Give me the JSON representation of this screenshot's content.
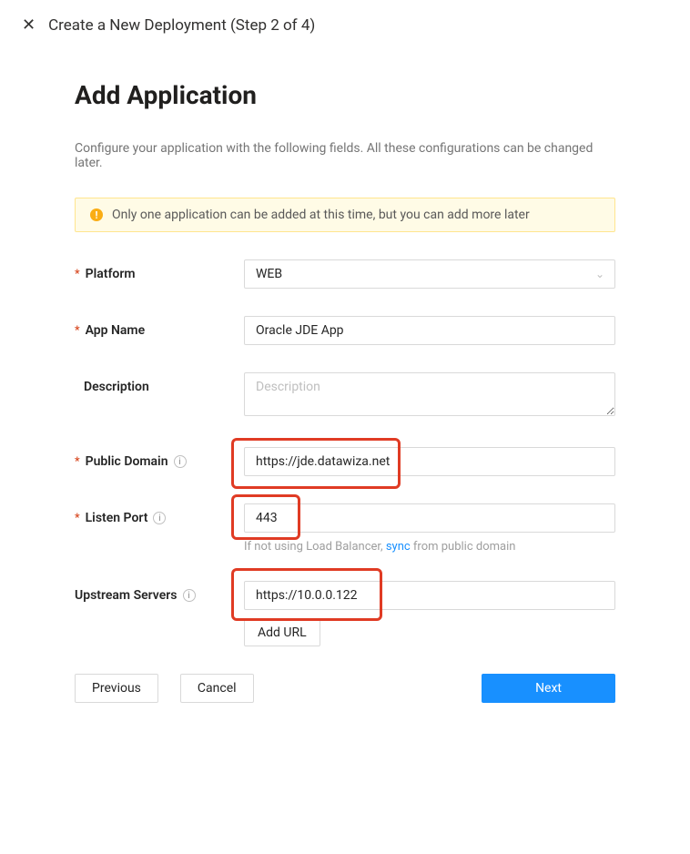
{
  "header": {
    "close_glyph": "✕",
    "title": "Create a New Deployment (Step 2 of 4)"
  },
  "page": {
    "title": "Add Application",
    "subtitle": "Configure your application with the following fields. All these configurations can be changed later."
  },
  "notice": {
    "icon_glyph": "!",
    "text": "Only one application can be added at this time, but you can add more later"
  },
  "fields": {
    "platform": {
      "label": "Platform",
      "value": "WEB"
    },
    "app_name": {
      "label": "App Name",
      "value": "Oracle JDE App"
    },
    "description": {
      "label": "Description",
      "placeholder": "Description",
      "value": ""
    },
    "public_domain": {
      "label": "Public Domain",
      "value": "https://jde.datawiza.net"
    },
    "listen_port": {
      "label": "Listen Port",
      "value": "443",
      "helper_prefix": "If not using Load Balancer, ",
      "helper_link": "sync",
      "helper_suffix": " from public domain"
    },
    "upstream": {
      "label": "Upstream Servers",
      "value": "https://10.0.0.122",
      "add_url_label": "Add URL"
    }
  },
  "buttons": {
    "previous": "Previous",
    "cancel": "Cancel",
    "next": "Next"
  }
}
